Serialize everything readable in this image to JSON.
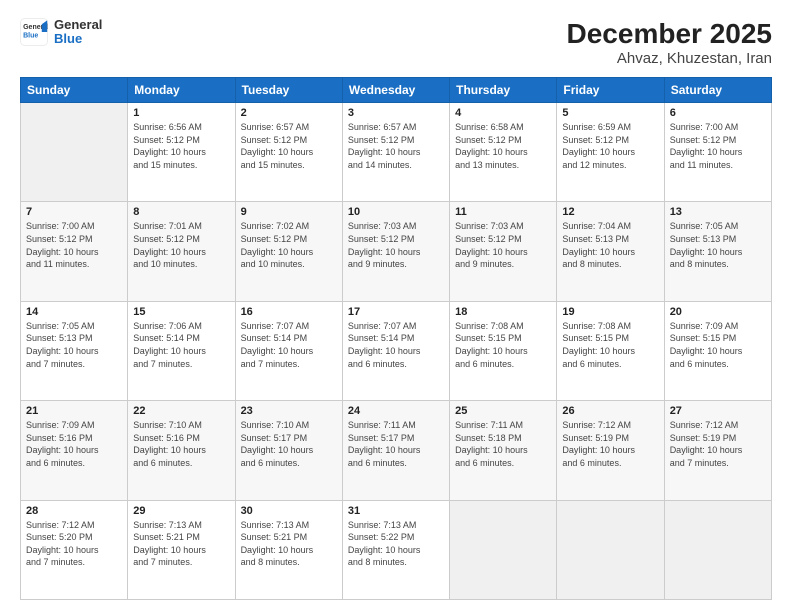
{
  "header": {
    "logo": {
      "general": "General",
      "blue": "Blue"
    },
    "title": "December 2025",
    "subtitle": "Ahvaz, Khuzestan, Iran"
  },
  "weekdays": [
    "Sunday",
    "Monday",
    "Tuesday",
    "Wednesday",
    "Thursday",
    "Friday",
    "Saturday"
  ],
  "weeks": [
    [
      {
        "day": "",
        "info": ""
      },
      {
        "day": "1",
        "info": "Sunrise: 6:56 AM\nSunset: 5:12 PM\nDaylight: 10 hours\nand 15 minutes."
      },
      {
        "day": "2",
        "info": "Sunrise: 6:57 AM\nSunset: 5:12 PM\nDaylight: 10 hours\nand 15 minutes."
      },
      {
        "day": "3",
        "info": "Sunrise: 6:57 AM\nSunset: 5:12 PM\nDaylight: 10 hours\nand 14 minutes."
      },
      {
        "day": "4",
        "info": "Sunrise: 6:58 AM\nSunset: 5:12 PM\nDaylight: 10 hours\nand 13 minutes."
      },
      {
        "day": "5",
        "info": "Sunrise: 6:59 AM\nSunset: 5:12 PM\nDaylight: 10 hours\nand 12 minutes."
      },
      {
        "day": "6",
        "info": "Sunrise: 7:00 AM\nSunset: 5:12 PM\nDaylight: 10 hours\nand 11 minutes."
      }
    ],
    [
      {
        "day": "7",
        "info": "Sunrise: 7:00 AM\nSunset: 5:12 PM\nDaylight: 10 hours\nand 11 minutes."
      },
      {
        "day": "8",
        "info": "Sunrise: 7:01 AM\nSunset: 5:12 PM\nDaylight: 10 hours\nand 10 minutes."
      },
      {
        "day": "9",
        "info": "Sunrise: 7:02 AM\nSunset: 5:12 PM\nDaylight: 10 hours\nand 10 minutes."
      },
      {
        "day": "10",
        "info": "Sunrise: 7:03 AM\nSunset: 5:12 PM\nDaylight: 10 hours\nand 9 minutes."
      },
      {
        "day": "11",
        "info": "Sunrise: 7:03 AM\nSunset: 5:12 PM\nDaylight: 10 hours\nand 9 minutes."
      },
      {
        "day": "12",
        "info": "Sunrise: 7:04 AM\nSunset: 5:13 PM\nDaylight: 10 hours\nand 8 minutes."
      },
      {
        "day": "13",
        "info": "Sunrise: 7:05 AM\nSunset: 5:13 PM\nDaylight: 10 hours\nand 8 minutes."
      }
    ],
    [
      {
        "day": "14",
        "info": "Sunrise: 7:05 AM\nSunset: 5:13 PM\nDaylight: 10 hours\nand 7 minutes."
      },
      {
        "day": "15",
        "info": "Sunrise: 7:06 AM\nSunset: 5:14 PM\nDaylight: 10 hours\nand 7 minutes."
      },
      {
        "day": "16",
        "info": "Sunrise: 7:07 AM\nSunset: 5:14 PM\nDaylight: 10 hours\nand 7 minutes."
      },
      {
        "day": "17",
        "info": "Sunrise: 7:07 AM\nSunset: 5:14 PM\nDaylight: 10 hours\nand 6 minutes."
      },
      {
        "day": "18",
        "info": "Sunrise: 7:08 AM\nSunset: 5:15 PM\nDaylight: 10 hours\nand 6 minutes."
      },
      {
        "day": "19",
        "info": "Sunrise: 7:08 AM\nSunset: 5:15 PM\nDaylight: 10 hours\nand 6 minutes."
      },
      {
        "day": "20",
        "info": "Sunrise: 7:09 AM\nSunset: 5:15 PM\nDaylight: 10 hours\nand 6 minutes."
      }
    ],
    [
      {
        "day": "21",
        "info": "Sunrise: 7:09 AM\nSunset: 5:16 PM\nDaylight: 10 hours\nand 6 minutes."
      },
      {
        "day": "22",
        "info": "Sunrise: 7:10 AM\nSunset: 5:16 PM\nDaylight: 10 hours\nand 6 minutes."
      },
      {
        "day": "23",
        "info": "Sunrise: 7:10 AM\nSunset: 5:17 PM\nDaylight: 10 hours\nand 6 minutes."
      },
      {
        "day": "24",
        "info": "Sunrise: 7:11 AM\nSunset: 5:17 PM\nDaylight: 10 hours\nand 6 minutes."
      },
      {
        "day": "25",
        "info": "Sunrise: 7:11 AM\nSunset: 5:18 PM\nDaylight: 10 hours\nand 6 minutes."
      },
      {
        "day": "26",
        "info": "Sunrise: 7:12 AM\nSunset: 5:19 PM\nDaylight: 10 hours\nand 6 minutes."
      },
      {
        "day": "27",
        "info": "Sunrise: 7:12 AM\nSunset: 5:19 PM\nDaylight: 10 hours\nand 7 minutes."
      }
    ],
    [
      {
        "day": "28",
        "info": "Sunrise: 7:12 AM\nSunset: 5:20 PM\nDaylight: 10 hours\nand 7 minutes."
      },
      {
        "day": "29",
        "info": "Sunrise: 7:13 AM\nSunset: 5:21 PM\nDaylight: 10 hours\nand 7 minutes."
      },
      {
        "day": "30",
        "info": "Sunrise: 7:13 AM\nSunset: 5:21 PM\nDaylight: 10 hours\nand 8 minutes."
      },
      {
        "day": "31",
        "info": "Sunrise: 7:13 AM\nSunset: 5:22 PM\nDaylight: 10 hours\nand 8 minutes."
      },
      {
        "day": "",
        "info": ""
      },
      {
        "day": "",
        "info": ""
      },
      {
        "day": "",
        "info": ""
      }
    ]
  ]
}
